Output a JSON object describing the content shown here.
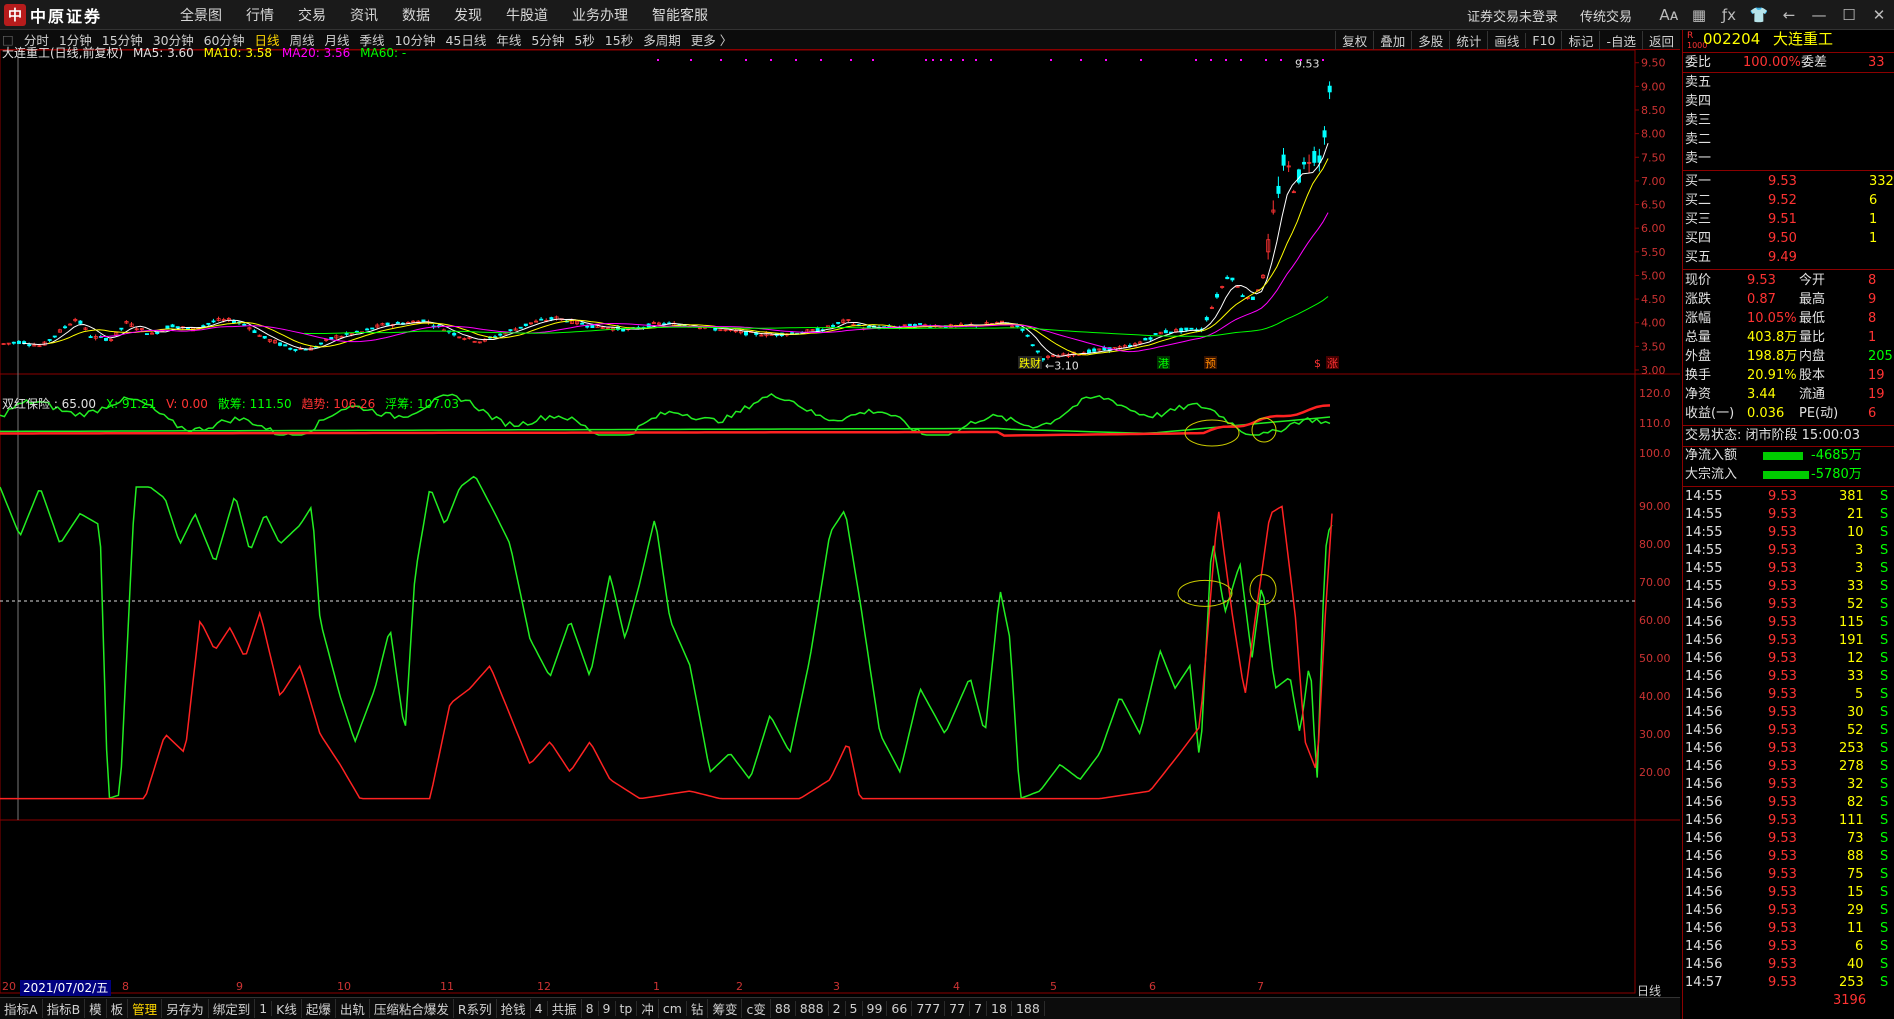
{
  "app": {
    "logo_text": "中原证券",
    "logo_mark": "中",
    "nav": [
      "全景图",
      "行情",
      "交易",
      "资讯",
      "数据",
      "发现",
      "牛股道",
      "业务办理",
      "智能客服"
    ],
    "login_status": "证券交易未登录",
    "mode": "传统交易",
    "icons": [
      "font-size-icon",
      "grid-icon",
      "formula-icon",
      "skin-icon",
      "back-icon",
      "minimize-icon",
      "maximize-icon",
      "close-icon"
    ]
  },
  "periods": [
    "分时",
    "1分钟",
    "15分钟",
    "30分钟",
    "60分钟",
    "日线",
    "周线",
    "月线",
    "季线",
    "10分钟",
    "45日线",
    "年线",
    "5分钟",
    "5秒",
    "15秒",
    "多周期",
    "更多 〉"
  ],
  "active_period": "日线",
  "tools": [
    "复权",
    "叠加",
    "多股",
    "统计",
    "画线",
    "F10",
    "标记",
    "-自选",
    "返回"
  ],
  "main_legend": {
    "title": "大连重工(日线,前复权)",
    "ma5": "MA5: 3.60",
    "ma10": "MA10: 3.58",
    "ma20": "MA20: 3.56",
    "ma60": "MA60: -"
  },
  "price_axis": [
    "9.50",
    "9.00",
    "8.50",
    "8.00",
    "7.50",
    "7.00",
    "6.50",
    "6.00",
    "5.50",
    "5.00",
    "4.50",
    "4.00",
    "3.50",
    "3.00"
  ],
  "price_marks": {
    "high": "9.53",
    "low": "3.10"
  },
  "event_tags": [
    "跌财",
    "港",
    "预",
    "$",
    "涨"
  ],
  "indicator_legend": {
    "name": "双红保险 : 65.00",
    "x": "X: 91.21",
    "v": "V: 0.00",
    "s1": "散筹: 111.50",
    "s2": "趋势: 106.26",
    "s3": "浮筹: 107.03"
  },
  "upper_ind_axis": [
    "120.0",
    "110.0",
    "100.0"
  ],
  "lower_ind_axis": [
    "90.00",
    "80.00",
    "70.00",
    "60.00",
    "50.00",
    "40.00",
    "30.00",
    "20.00"
  ],
  "x_months": [
    "8",
    "9",
    "10",
    "11",
    "12",
    "1",
    "2",
    "3",
    "4",
    "5",
    "6",
    "7"
  ],
  "x_start": "20",
  "cursor_date": "2021/07/02/五",
  "period_label": "日线",
  "bottom_tabs": [
    "指标A",
    "指标B",
    "模",
    "板",
    "管理",
    "另存为",
    "绑定到",
    "1",
    "K线",
    "起爆",
    "出轨",
    "压缩粘合爆发",
    "R系列",
    "抢钱",
    "4",
    "共振",
    "8",
    "9",
    "tp",
    "冲",
    "cm",
    "钻",
    "筹变",
    "c变",
    "88",
    "888",
    "2",
    "5",
    "99",
    "66",
    "777",
    "77",
    "7",
    "18",
    "188"
  ],
  "active_bottom": "管理",
  "quote": {
    "code": "002204",
    "name": "大连重工",
    "tag_r": "R",
    "tag_1000": "1000",
    "weibi_label": "委比",
    "weibi": "100.00%",
    "weicha_label": "委差",
    "weicha": "33",
    "asks": [
      {
        "label": "卖五"
      },
      {
        "label": "卖四"
      },
      {
        "label": "卖三"
      },
      {
        "label": "卖二"
      },
      {
        "label": "卖一"
      }
    ],
    "bids": [
      {
        "label": "买一",
        "price": "9.53",
        "vol": "332"
      },
      {
        "label": "买二",
        "price": "9.52",
        "vol": "6"
      },
      {
        "label": "买三",
        "price": "9.51",
        "vol": "1"
      },
      {
        "label": "买四",
        "price": "9.50",
        "vol": "1"
      },
      {
        "label": "买五",
        "price": "9.49",
        "vol": ""
      }
    ],
    "stats": [
      {
        "l1": "现价",
        "v1": "9.53",
        "l2": "今开",
        "v2": "8"
      },
      {
        "l1": "涨跌",
        "v1": "0.87",
        "l2": "最高",
        "v2": "9"
      },
      {
        "l1": "涨幅",
        "v1": "10.05%",
        "l2": "最低",
        "v2": "8"
      },
      {
        "l1": "总量",
        "v1": "403.8万",
        "l2": "量比",
        "v2": "1"
      },
      {
        "l1": "外盘",
        "v1": "198.8万",
        "l2": "内盘",
        "v2": "205."
      },
      {
        "l1": "换手",
        "v1": "20.91%",
        "l2": "股本",
        "v2": "19"
      },
      {
        "l1": "净资",
        "v1": "3.44",
        "l2": "流通",
        "v2": "19"
      },
      {
        "l1": "收益(一)",
        "v1": "0.036",
        "l2": "PE(动)",
        "v2": "6"
      }
    ],
    "trade_status": "交易状态: 闭市阶段 15:00:03",
    "net_inflow_label": "净流入额",
    "net_inflow": "-4685万",
    "big_inflow_label": "大宗流入",
    "big_inflow": "-5780万",
    "ticks": [
      {
        "t": "14:55",
        "p": "9.53",
        "v": "381",
        "s": "S"
      },
      {
        "t": "14:55",
        "p": "9.53",
        "v": "21",
        "s": "S"
      },
      {
        "t": "14:55",
        "p": "9.53",
        "v": "10",
        "s": "S"
      },
      {
        "t": "14:55",
        "p": "9.53",
        "v": "3",
        "s": "S"
      },
      {
        "t": "14:55",
        "p": "9.53",
        "v": "3",
        "s": "S"
      },
      {
        "t": "14:55",
        "p": "9.53",
        "v": "33",
        "s": "S"
      },
      {
        "t": "14:56",
        "p": "9.53",
        "v": "52",
        "s": "S"
      },
      {
        "t": "14:56",
        "p": "9.53",
        "v": "115",
        "s": "S"
      },
      {
        "t": "14:56",
        "p": "9.53",
        "v": "191",
        "s": "S"
      },
      {
        "t": "14:56",
        "p": "9.53",
        "v": "12",
        "s": "S"
      },
      {
        "t": "14:56",
        "p": "9.53",
        "v": "33",
        "s": "S"
      },
      {
        "t": "14:56",
        "p": "9.53",
        "v": "5",
        "s": "S"
      },
      {
        "t": "14:56",
        "p": "9.53",
        "v": "30",
        "s": "S"
      },
      {
        "t": "14:56",
        "p": "9.53",
        "v": "52",
        "s": "S"
      },
      {
        "t": "14:56",
        "p": "9.53",
        "v": "253",
        "s": "S"
      },
      {
        "t": "14:56",
        "p": "9.53",
        "v": "278",
        "s": "S"
      },
      {
        "t": "14:56",
        "p": "9.53",
        "v": "32",
        "s": "S"
      },
      {
        "t": "14:56",
        "p": "9.53",
        "v": "82",
        "s": "S"
      },
      {
        "t": "14:56",
        "p": "9.53",
        "v": "111",
        "s": "S"
      },
      {
        "t": "14:56",
        "p": "9.53",
        "v": "73",
        "s": "S"
      },
      {
        "t": "14:56",
        "p": "9.53",
        "v": "88",
        "s": "S"
      },
      {
        "t": "14:56",
        "p": "9.53",
        "v": "75",
        "s": "S"
      },
      {
        "t": "14:56",
        "p": "9.53",
        "v": "15",
        "s": "S"
      },
      {
        "t": "14:56",
        "p": "9.53",
        "v": "29",
        "s": "S"
      },
      {
        "t": "14:56",
        "p": "9.53",
        "v": "11",
        "s": "S"
      },
      {
        "t": "14:56",
        "p": "9.53",
        "v": "6",
        "s": "S"
      },
      {
        "t": "14:56",
        "p": "9.53",
        "v": "40",
        "s": "S"
      },
      {
        "t": "14:57",
        "p": "9.53",
        "v": "253",
        "s": "S"
      }
    ],
    "last_tick_partial": "3196"
  },
  "colors": {
    "up": "#ff3333",
    "down": "#00ffff",
    "ma5": "#ffffff",
    "ma10": "#ffff00",
    "ma20": "#ff00ff",
    "ma60": "#00ff00",
    "ind_green": "#22ee22",
    "ind_red": "#ff2222",
    "grid": "#8b0000"
  },
  "chart_data": {
    "type": "line",
    "price_ylim": [
      3.0,
      9.6
    ],
    "upper_ylim": [
      95,
      125
    ],
    "lower_ylim": [
      10,
      100
    ],
    "ref_line": 65.0
  }
}
